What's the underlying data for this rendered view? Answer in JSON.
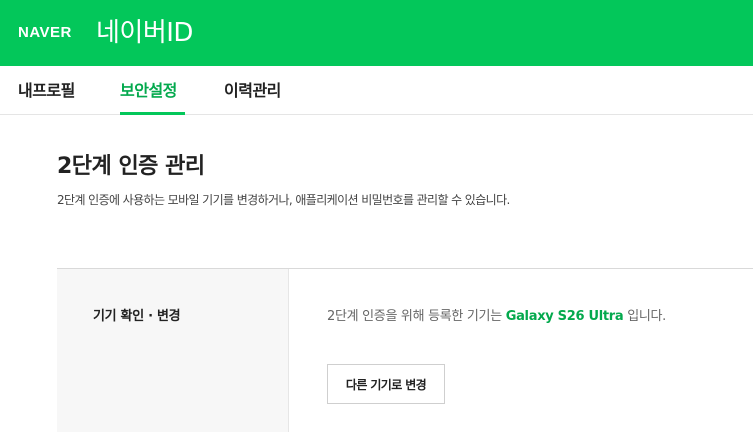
{
  "header": {
    "logo_text": "NAVER",
    "title": "네이버ID",
    "background_color": "#03c75a"
  },
  "tabs": [
    {
      "label": "내프로필",
      "active": false
    },
    {
      "label": "보안설정",
      "active": true
    },
    {
      "label": "이력관리",
      "active": false
    }
  ],
  "main": {
    "title": "2단계 인증 관리",
    "description": "2단계 인증에 사용하는 모바일 기기를 변경하거나, 애플리케이션 비밀번호를 관리할 수 있습니다.",
    "device_section": {
      "label": "기기 확인 · 변경",
      "info_prefix": "2단계 인증을 위해 등록한 기기는 ",
      "device_name": "Galaxy S26 Ultra",
      "info_suffix": " 입니다.",
      "change_button_label": "다른 기기로 변경"
    }
  },
  "colors": {
    "accent": "#03c75a",
    "accent_text": "#03a94d"
  }
}
